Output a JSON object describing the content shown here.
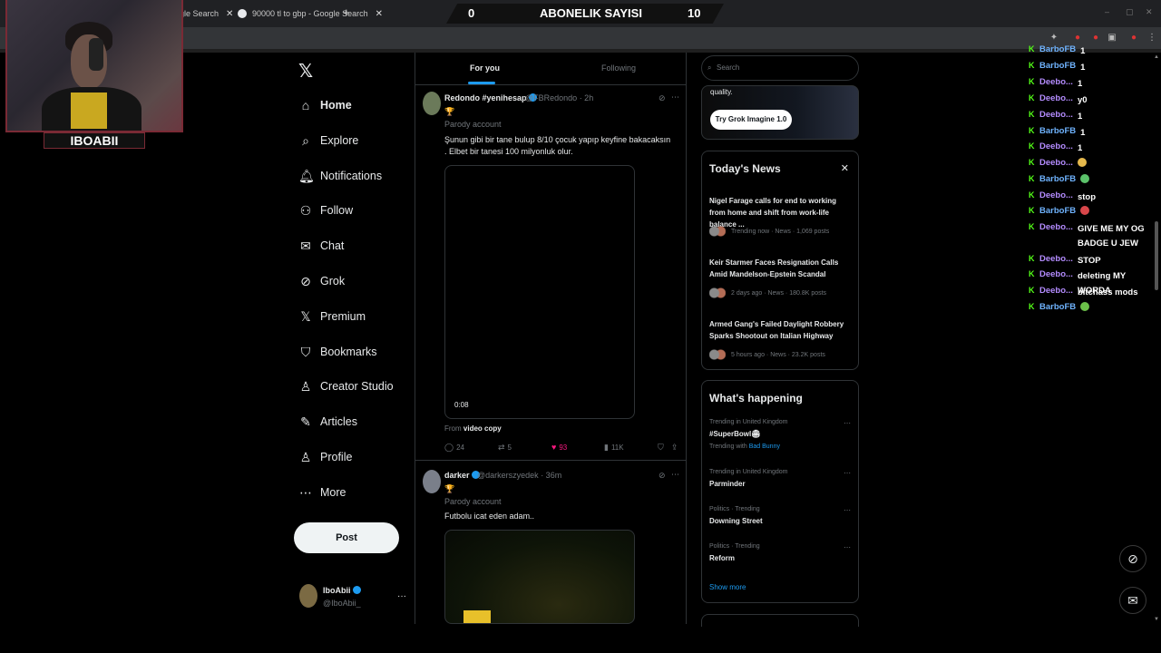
{
  "browser": {
    "tabs": [
      {
        "title": "gle Search",
        "close": "✕"
      },
      {
        "title": "90000 tl to gbp - Google Search",
        "close": "✕"
      }
    ],
    "new_tab": "+",
    "window_controls": [
      "–",
      "▢",
      "✕"
    ]
  },
  "overlay": {
    "left_value": "0",
    "title": "ABONELIK SAYISI",
    "right_value": "10",
    "streamer": "IBOABII"
  },
  "nav": {
    "logo": "𝕏",
    "items": [
      {
        "label": "Home",
        "icon": "home-icon",
        "glyph": "⌂"
      },
      {
        "label": "Explore",
        "icon": "search-icon",
        "glyph": "⌕"
      },
      {
        "label": "Notifications",
        "icon": "bell-icon",
        "glyph": "🔔︎"
      },
      {
        "label": "Follow",
        "icon": "follow-icon",
        "glyph": "⚇"
      },
      {
        "label": "Chat",
        "icon": "mail-icon",
        "glyph": "✉"
      },
      {
        "label": "Grok",
        "icon": "grok-icon",
        "glyph": "⊘"
      },
      {
        "label": "Premium",
        "icon": "x-premium-icon",
        "glyph": "𝕏"
      },
      {
        "label": "Bookmarks",
        "icon": "bookmark-icon",
        "glyph": "⛉"
      },
      {
        "label": "Creator Studio",
        "icon": "creator-studio-icon",
        "glyph": "♙"
      },
      {
        "label": "Articles",
        "icon": "articles-icon",
        "glyph": "✎"
      },
      {
        "label": "Profile",
        "icon": "profile-icon",
        "glyph": "♙"
      },
      {
        "label": "More",
        "icon": "more-icon",
        "glyph": "⋯"
      }
    ],
    "post_label": "Post",
    "account": {
      "name": "IboAbii",
      "handle": "@IboAbii_",
      "more": "···"
    }
  },
  "timeline": {
    "tabs": [
      "For you",
      "Following"
    ],
    "tweets": [
      {
        "name": "Redondo #yenihesap",
        "handle": "@FBRedondo",
        "time": "· 2h",
        "emoji": "🏆",
        "label": "Parody account",
        "text": "Şunun gibi bir tane bulup 8/10 çocuk yapıp keyfine bakacaksın . Elbet bir tanesi 100 milyonluk olur.",
        "video_time": "0:08",
        "from_prefix": "From",
        "from_source": "video copy",
        "replies": "24",
        "reposts": "5",
        "likes": "93",
        "views": "11K"
      },
      {
        "name": "darker",
        "handle": "@darkerszyedek",
        "time": "· 36m",
        "emoji": "🏆",
        "label": "Parody account",
        "text": "Futbolu icat eden adam.."
      }
    ]
  },
  "right": {
    "search_placeholder": "Search",
    "grok": {
      "text": "quality.",
      "button": "Try Grok Imagine 1.0"
    },
    "news": {
      "title": "Today's News",
      "close": "✕",
      "items": [
        {
          "headline": "Nigel Farage calls for end to working from home and shift from work-life balance ...",
          "meta": "Trending now · News · 1,069 posts"
        },
        {
          "headline": "Keir Starmer Faces Resignation Calls Amid Mandelson-Epstein Scandal",
          "meta": "2 days ago · News · 180.8K posts"
        },
        {
          "headline": "Armed Gang's Failed Daylight Robbery Sparks Shootout on Italian Highway",
          "meta": "5 hours ago · News · 23.2K posts"
        }
      ]
    },
    "happening": {
      "title": "What's happening",
      "trends": [
        {
          "context": "Trending in United Kingdom",
          "name": "#SuperBowl🏟",
          "sub_prefix": "Trending with",
          "sub_link": "Bad Bunny"
        },
        {
          "context": "Trending in United Kingdom",
          "name": "Parminder"
        },
        {
          "context": "Politics · Trending",
          "name": "Downing Street"
        },
        {
          "context": "Politics · Trending",
          "name": "Reform"
        }
      ],
      "show_more": "Show more"
    }
  },
  "chat": {
    "messages": [
      {
        "user": "BarboFB",
        "msg": "1",
        "color": "#6fb3ff"
      },
      {
        "user": "BarboFB",
        "msg": "1",
        "color": "#6fb3ff"
      },
      {
        "user": "Deebo...",
        "msg": "1",
        "color": "#b48cff"
      },
      {
        "user": "Deebo...",
        "msg": "y0",
        "color": "#b48cff"
      },
      {
        "user": "Deebo...",
        "msg": "1",
        "color": "#b48cff"
      },
      {
        "user": "BarboFB",
        "msg": "1",
        "color": "#6fb3ff"
      },
      {
        "user": "Deebo...",
        "msg": "1",
        "color": "#b48cff"
      },
      {
        "user": "Deebo...",
        "msg": "",
        "color": "#b48cff",
        "emote": "#e6b94d"
      },
      {
        "user": "BarboFB",
        "msg": "",
        "color": "#6fb3ff",
        "emote": "#5bc26a"
      },
      {
        "user": "Deebo...",
        "msg": "stop",
        "color": "#b48cff"
      },
      {
        "user": "BarboFB",
        "msg": "",
        "color": "#6fb3ff",
        "emote": "#d8464a"
      },
      {
        "user": "Deebo...",
        "msg": "GIVE ME MY OG BADGE U JEW",
        "color": "#b48cff"
      },
      {
        "user": "Deebo...",
        "msg": "STOP",
        "color": "#b48cff"
      },
      {
        "user": "Deebo...",
        "msg": "deleting MY WORDA",
        "color": "#b48cff"
      },
      {
        "user": "Deebo...",
        "msg": "bitchass mods",
        "color": "#b48cff"
      },
      {
        "user": "BarboFB",
        "msg": "",
        "color": "#6fb3ff",
        "emote": "#6cc04a"
      }
    ]
  },
  "float": {
    "grok_glyph": "⊘",
    "mail_glyph": "✉"
  }
}
